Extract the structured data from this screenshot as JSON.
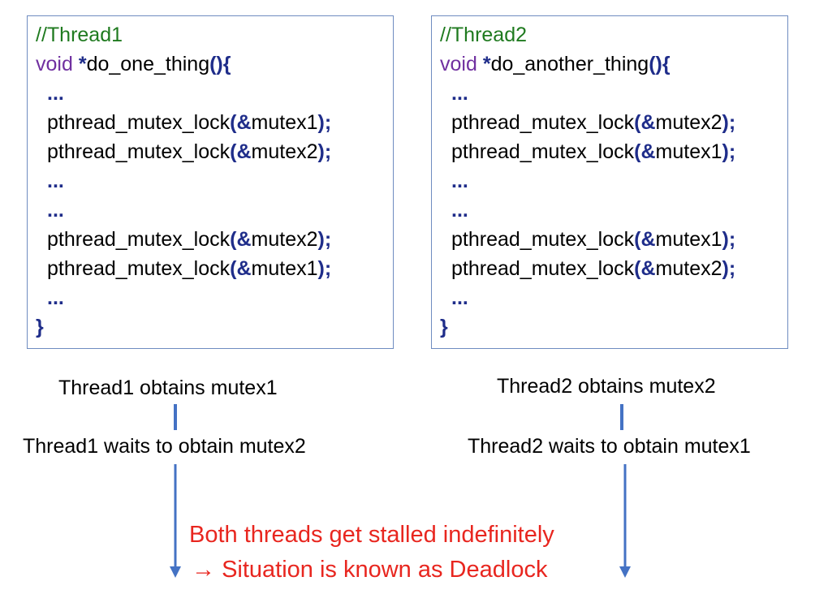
{
  "thread1": {
    "comment": "//Thread1",
    "kw_void": "void",
    "func_name": "do_one_thing",
    "lines": [
      {
        "fn": "pthread_mutex_lock",
        "arg": "mutex1"
      },
      {
        "fn": "pthread_mutex_lock",
        "arg": "mutex2"
      },
      {
        "fn": "pthread_mutex_lock",
        "arg": "mutex2"
      },
      {
        "fn": "pthread_mutex_lock",
        "arg": "mutex1"
      }
    ],
    "ellipsis": "...",
    "close_brace": "}",
    "caption_obtains": "Thread1 obtains mutex1",
    "caption_waits": "Thread1 waits to obtain mutex2"
  },
  "thread2": {
    "comment": "//Thread2",
    "kw_void": "void",
    "func_name": "do_another_thing",
    "lines": [
      {
        "fn": "pthread_mutex_lock",
        "arg": "mutex2"
      },
      {
        "fn": "pthread_mutex_lock",
        "arg": "mutex1"
      },
      {
        "fn": "pthread_mutex_lock",
        "arg": "mutex1"
      },
      {
        "fn": "pthread_mutex_lock",
        "arg": "mutex2"
      }
    ],
    "ellipsis": "...",
    "close_brace": "}",
    "caption_obtains": "Thread2 obtains mutex2",
    "caption_waits": "Thread2 waits to obtain mutex1"
  },
  "tokens": {
    "star": "*",
    "parens_open_brace": "(){",
    "open_paren_amp": "(&",
    "close_paren_semi": ");"
  },
  "note": {
    "line1": "Both threads get stalled indefinitely",
    "arrow_symbol": "→",
    "line2": "Situation is known as Deadlock"
  },
  "colors": {
    "comment": "#1f7a1f",
    "keyword": "#7030a0",
    "symbol": "#1f2d8a",
    "box_border": "#6f8cc0",
    "arrow": "#4472c4",
    "note": "#e8261f"
  }
}
